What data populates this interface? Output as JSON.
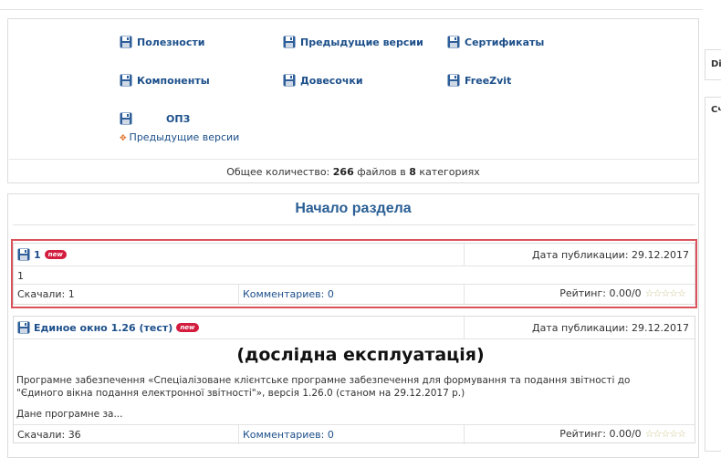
{
  "categories": [
    {
      "label": "Полезности"
    },
    {
      "label": "Предыдущие версии"
    },
    {
      "label": "Сертификаты"
    },
    {
      "label": "Компоненты"
    },
    {
      "label": "Довесочки"
    },
    {
      "label": "FreeZvit"
    },
    {
      "label": "ОПЗ"
    }
  ],
  "sublink": "Предыдущие версии",
  "totals": {
    "prefix": "Общее количество:",
    "files": "266",
    "files_word": "файлов в",
    "cats": "8",
    "cats_word": "категориях"
  },
  "section_title": "Начало раздела",
  "files": [
    {
      "name": "1",
      "badge": "new",
      "pub_date": "Дата публикации: 29.12.2017",
      "description": "1",
      "downloads": "Скачали: 1",
      "comments": "Комментариев: 0",
      "rating": "Рейтинг: 0.00/0",
      "stars": "☆☆☆☆☆"
    },
    {
      "name": "Единое окно 1.26 (тест)",
      "badge": "new",
      "pub_date": "Дата публикации: 29.12.2017",
      "big_title": "(дослідна експлуатація)",
      "description": "Програмне забезпечення «Спеціалізоване клієнтське програмне забезпечення для формування та подання звітності до \"Єдиного вікна подання електронної звітності\"», версія 1.26.0 (станом на 29.12.2017 р.)",
      "description_more": "Дане програмне за...",
      "downloads": "Скачали: 36",
      "comments": "Комментариев: 0",
      "rating": "Рейтинг: 0.00/0",
      "stars": "☆☆☆☆☆"
    }
  ],
  "side_panels": [
    {
      "label": "Di"
    },
    {
      "label": "Сч"
    }
  ]
}
